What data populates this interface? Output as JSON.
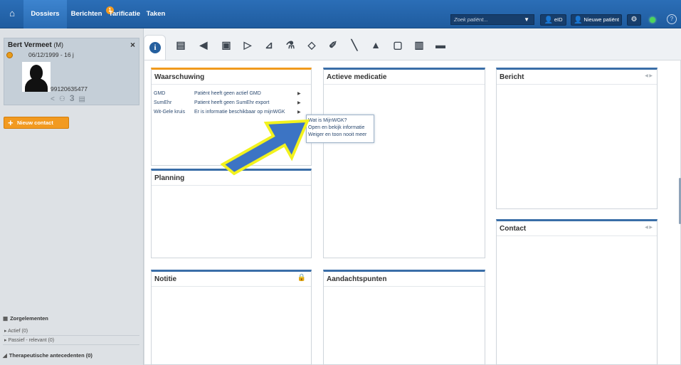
{
  "topnav": {
    "tabs": [
      {
        "label": "Dossiers"
      },
      {
        "label": "Berichten"
      },
      {
        "label": "Tarificatie"
      },
      {
        "label": "Taken"
      }
    ],
    "berichten_badge": "1",
    "search_placeholder": "Zoek patiënt...",
    "eid_label": "eID",
    "new_patient_label": "Nieuwe patiënt"
  },
  "patient": {
    "name": "Bert Vermeet",
    "gender": "(M)",
    "dob": "06/12/1999 - 16 j",
    "number": "99120635477",
    "count": "3"
  },
  "sidebar": {
    "new_contact": "Nieuw contact",
    "zorgelementen": "Zorgelementen",
    "actief": "▸ Actief (0)",
    "passief": "▸ Passief - relevant (0)",
    "therapeutische": "Therapeutische antecedenten (0)"
  },
  "panels": {
    "waarschuwing": {
      "title": "Waarschuwing",
      "rows": [
        {
          "key": "GMD",
          "value": "Patiënt heeft geen actief GMD"
        },
        {
          "key": "SumEhr",
          "value": "Patient heeft geen SumEhr export"
        },
        {
          "key": "Wit-Gele kruis",
          "value": "Er is informatie beschikbaar op mijnWGK"
        }
      ]
    },
    "actieve_medicatie": {
      "title": "Actieve medicatie"
    },
    "bericht": {
      "title": "Bericht"
    },
    "planning": {
      "title": "Planning"
    },
    "contact": {
      "title": "Contact"
    },
    "notitie": {
      "title": "Notitie"
    },
    "aandachtspunten": {
      "title": "Aandachtspunten"
    }
  },
  "context_menu": {
    "items": [
      {
        "label": "Wat is MijnWGK?"
      },
      {
        "label": "Open en bekijk informatie"
      },
      {
        "label": "Weiger en toon nooit meer"
      }
    ]
  },
  "colors": {
    "topbar": "#2565ad",
    "accent_orange": "#f29a20",
    "panel_border_blue": "#3a6ea8",
    "annotation_arrow_fill": "#3c74c4",
    "annotation_arrow_outline": "#f2f21e"
  },
  "icons": {
    "tabs": [
      "info-icon",
      "clapperboard-icon",
      "megaphone-icon",
      "medical-bag-icon",
      "document-arrow-icon",
      "chart-icon",
      "flask-icon",
      "pill-icon",
      "syringe-icon",
      "scalpel-icon",
      "warning-icon",
      "id-card-icon",
      "clipboard-icon",
      "monitor-icon"
    ]
  }
}
